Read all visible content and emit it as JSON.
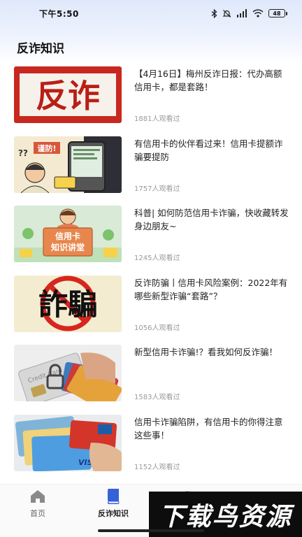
{
  "status_bar": {
    "time": "下午5:50",
    "battery": "48",
    "icons": [
      "bluetooth-icon",
      "mute-icon",
      "signal-icon",
      "wifi-icon",
      "battery-icon"
    ]
  },
  "page": {
    "title": "反诈知识"
  },
  "articles": [
    {
      "title": "【4月16日】梅州反诈日报：代办高额信用卡，都是套路！",
      "views": "1881人观看过",
      "thumb": "反诈"
    },
    {
      "title": "有信用卡的伙伴看过来！信用卡提额诈骗要提防",
      "views": "1757人观看过",
      "thumb": "谨防!"
    },
    {
      "title": "科普| 如何防范信用卡诈骗，快收藏转发身边朋友~",
      "views": "1245人观看过",
      "thumb": [
        "信用卡",
        "知识讲堂"
      ]
    },
    {
      "title": "反诈防骗丨信用卡风险案例：2022年有哪些新型诈骗“套路”？",
      "views": "1056人观看过",
      "thumb": "詐騙"
    },
    {
      "title": "新型信用卡诈骗!？看我如何反诈骗！",
      "views": "1583人观看过",
      "thumb": "Credit Card"
    },
    {
      "title": "信用卡诈骗陷阱，有信用卡的你得注意这些事！",
      "views": "1152人观看过",
      "thumb": "VISA"
    }
  ],
  "tab_bar": {
    "tabs": [
      {
        "label": "首页",
        "icon": "home-icon",
        "active": false
      },
      {
        "label": "反诈知识",
        "icon": "book-icon",
        "active": true
      }
    ]
  },
  "watermark": {
    "text": "下载鸟资源"
  },
  "colors": {
    "accent": "#3562d8",
    "background": "#ffffff",
    "gradient_top": "#dfe8fb"
  }
}
